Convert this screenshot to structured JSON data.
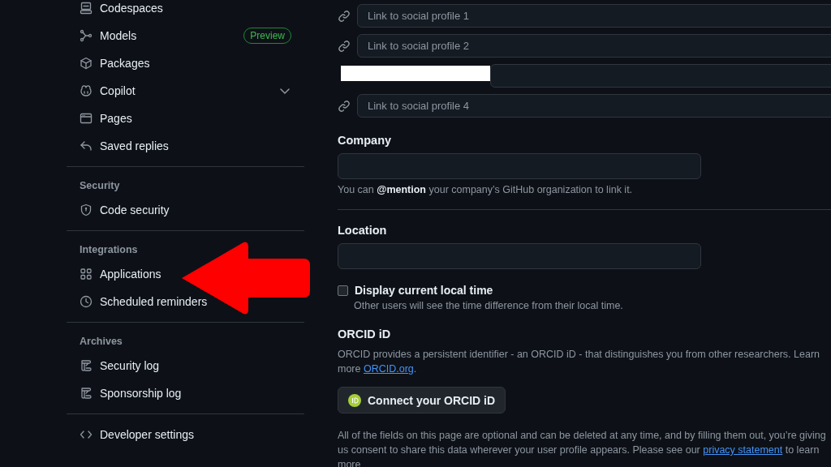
{
  "sidebar": {
    "sections": [
      {
        "items": [
          {
            "label": "Codespaces"
          },
          {
            "label": "Models",
            "badge": "Preview"
          },
          {
            "label": "Packages"
          },
          {
            "label": "Copilot",
            "expanded": false
          },
          {
            "label": "Pages"
          },
          {
            "label": "Saved replies"
          }
        ]
      },
      {
        "heading": "Security",
        "items": [
          {
            "label": "Code security"
          }
        ]
      },
      {
        "heading": "Integrations",
        "items": [
          {
            "label": "Applications"
          },
          {
            "label": "Scheduled reminders"
          }
        ]
      },
      {
        "heading": "Archives",
        "items": [
          {
            "label": "Security log"
          },
          {
            "label": "Sponsorship log"
          }
        ]
      },
      {
        "items": [
          {
            "label": "Developer settings"
          }
        ]
      }
    ]
  },
  "social_links": [
    {
      "placeholder": "Link to social profile 1"
    },
    {
      "placeholder": "Link to social profile 2"
    },
    {
      "redacted": true
    },
    {
      "placeholder": "Link to social profile 4"
    }
  ],
  "company": {
    "label": "Company",
    "help": "You can **@mention** your company’s GitHub organization to link it."
  },
  "location": {
    "label": "Location"
  },
  "local_time": {
    "label": "Display current local time",
    "checked": false,
    "help": "Other users will see the time difference from their local time."
  },
  "orcid": {
    "heading": "ORCID iD",
    "text": "ORCID provides a persistent identifier - an ORCID iD - that distinguishes you from other researchers. Learn more",
    "link": "ORCID.org",
    "after": ".",
    "button": "Connect your ORCID iD"
  },
  "footer_note": {
    "text": "All of the fields on this page are optional and can be deleted at any time, and by filling them out, you’re giving us consent to share this data wherever your user profile appears. Please see our",
    "link": "privacy statement",
    "after": "to learn more"
  },
  "annotation": {
    "kind": "arrow",
    "color": "#ff0000"
  }
}
